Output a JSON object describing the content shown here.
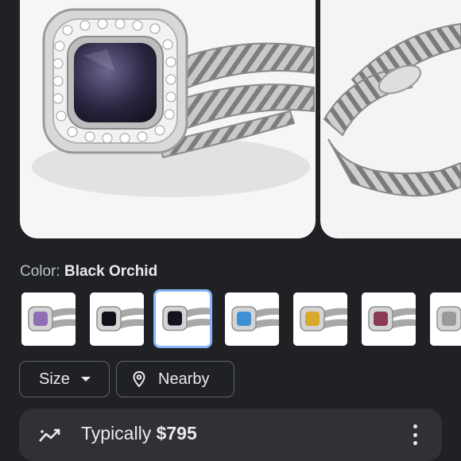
{
  "gallery": {
    "main_image": "ring-black-orchid-photo",
    "side_image": "ring-side-view-photo"
  },
  "color": {
    "label": "Color:",
    "selected": "Black Orchid"
  },
  "swatches": [
    {
      "stone": "#8e6fb4"
    },
    {
      "stone": "#101018"
    },
    {
      "stone": "#151320",
      "selected": true
    },
    {
      "stone": "#3d8fd6"
    },
    {
      "stone": "#d6a92a"
    },
    {
      "stone": "#8a3a52"
    },
    {
      "stone": "#9a9a9a"
    }
  ],
  "filters": {
    "size_label": "Size",
    "nearby_label": "Nearby"
  },
  "price": {
    "prefix": "Typically",
    "amount": "$795"
  },
  "colors": {
    "background": "#202124",
    "card": "#303134",
    "selected_outline": "#8ab4f8"
  }
}
